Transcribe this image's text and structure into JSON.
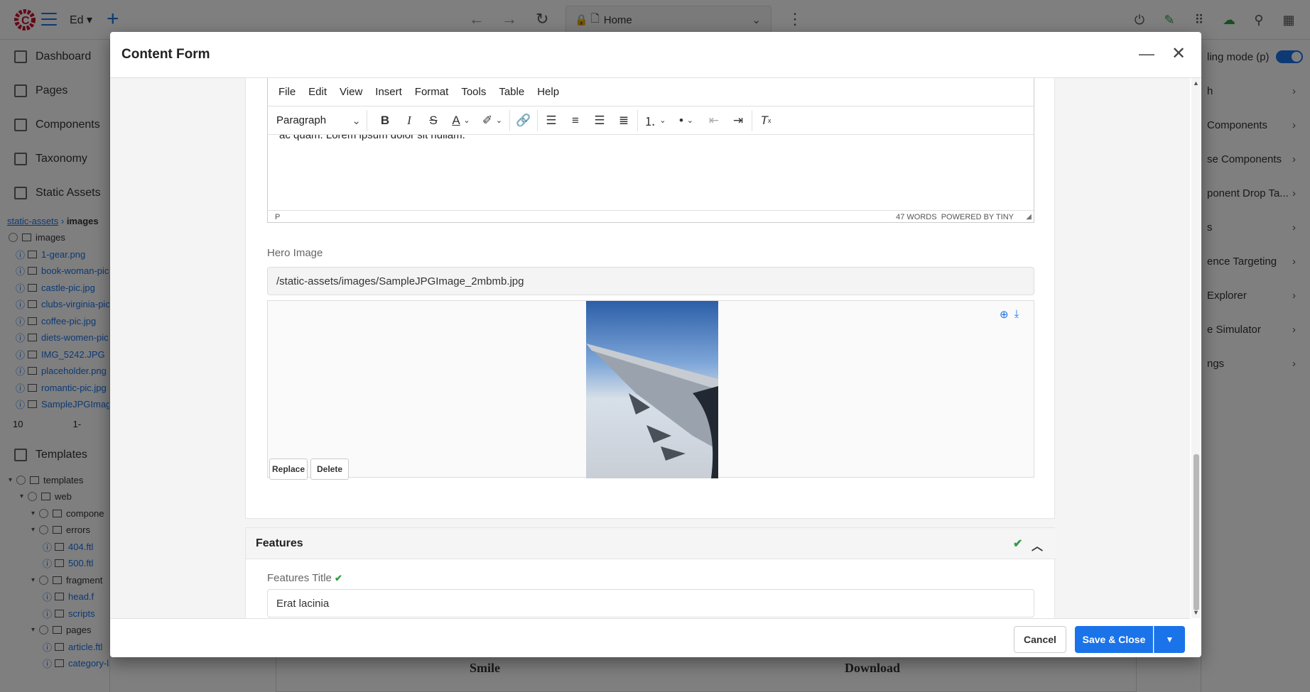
{
  "topbar": {
    "site": "Ed",
    "address": "Home"
  },
  "sidebar": {
    "items": [
      {
        "label": "Dashboard"
      },
      {
        "label": "Pages"
      },
      {
        "label": "Components"
      },
      {
        "label": "Taxonomy"
      },
      {
        "label": "Static Assets"
      }
    ],
    "breadcrumb": {
      "root": "static-assets",
      "current": "images"
    },
    "assets_folder": "images",
    "assets": [
      "1-gear.png",
      "book-woman-pic",
      "castle-pic.jpg",
      "clubs-virginia-pic",
      "coffee-pic.jpg",
      "diets-women-pic",
      "IMG_5242.JPG",
      "placeholder.png",
      "romantic-pic.jpg",
      "SampleJPGImage"
    ],
    "pager": {
      "size": "10",
      "pages": "1-"
    },
    "templates_label": "Templates",
    "template_tree": [
      {
        "label": "templates",
        "indent": 0,
        "type": "folder"
      },
      {
        "label": "web",
        "indent": 1,
        "type": "folder"
      },
      {
        "label": "compone",
        "indent": 2,
        "type": "folder"
      },
      {
        "label": "errors",
        "indent": 2,
        "type": "folder"
      },
      {
        "label": "404.ftl",
        "indent": 3,
        "type": "file"
      },
      {
        "label": "500.ftl",
        "indent": 3,
        "type": "file"
      },
      {
        "label": "fragment",
        "indent": 2,
        "type": "folder"
      },
      {
        "label": "head.f",
        "indent": 3,
        "type": "file"
      },
      {
        "label": "scripts",
        "indent": 3,
        "type": "file"
      },
      {
        "label": "pages",
        "indent": 2,
        "type": "folder"
      },
      {
        "label": "article.ftl",
        "indent": 3,
        "type": "file"
      },
      {
        "label": "category-landing.ftl",
        "indent": 3,
        "type": "file"
      }
    ]
  },
  "right_panel": {
    "editing_mode": "ling mode (p)",
    "items": [
      "h",
      "Components",
      "se Components",
      "ponent Drop Ta...",
      "s",
      "ence Targeting",
      "Explorer",
      "e Simulator",
      "ngs"
    ]
  },
  "preview": {
    "left_title": "Smile",
    "right_title": "Download"
  },
  "dialog": {
    "title": "Content Form",
    "editor": {
      "menus": [
        "File",
        "Edit",
        "View",
        "Insert",
        "Format",
        "Tools",
        "Table",
        "Help"
      ],
      "block_format": "Paragraph",
      "content_tail": "ac quam. Lorem ipsum dolor sit nullam.",
      "path": "P",
      "word_count": "47 WORDS",
      "powered_by": "POWERED BY TINY"
    },
    "hero_image": {
      "label": "Hero Image",
      "value": "/static-assets/images/SampleJPGImage_2mbmb.jpg",
      "replace_label": "Replace",
      "delete_label": "Delete"
    },
    "features": {
      "section_title": "Features",
      "title_label": "Features Title",
      "title_value": "Erat lacinia"
    },
    "footer": {
      "cancel_label": "Cancel",
      "save_label": "Save & Close"
    }
  },
  "colors": {
    "accent": "#1a73e8",
    "success": "#2e9e44"
  }
}
